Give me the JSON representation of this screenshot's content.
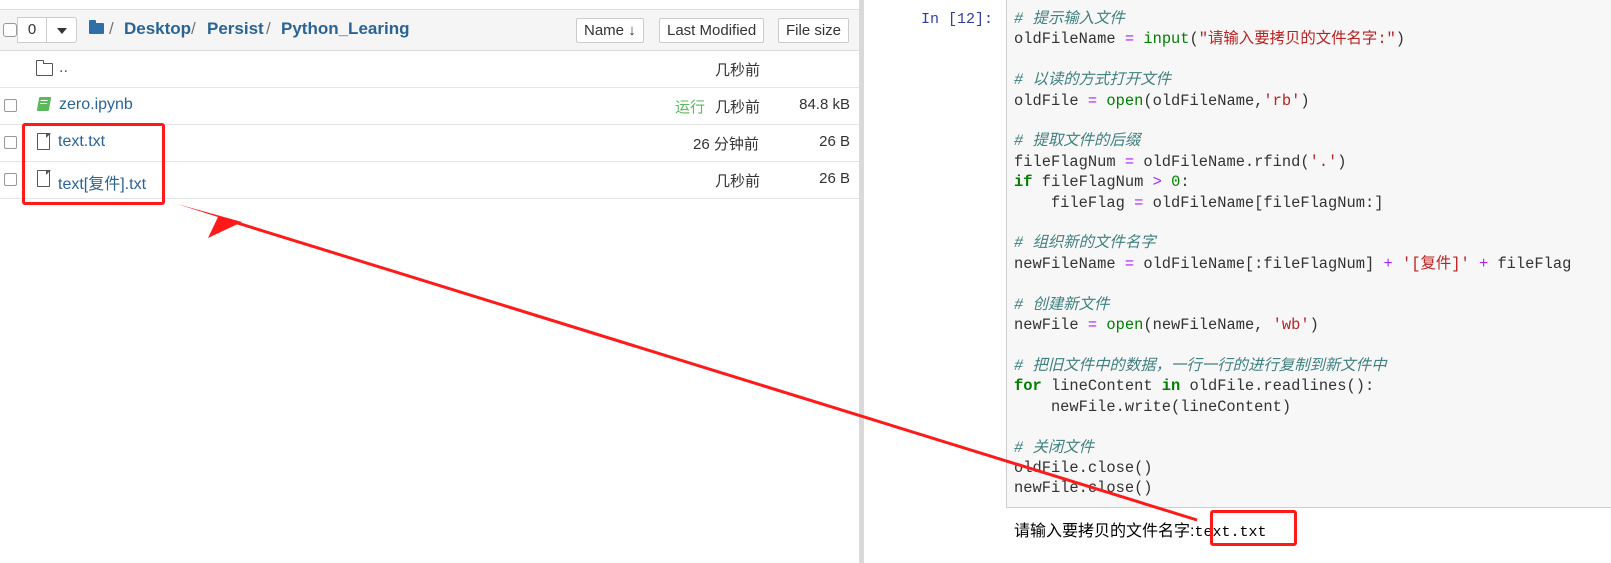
{
  "file_browser": {
    "selected_count": "0",
    "breadcrumb": [
      "Desktop",
      "Persist",
      "Python_Learing"
    ],
    "breadcrumb_sep": "/",
    "sort": {
      "name_label": "Name",
      "name_arrow": "🡻",
      "modified_label": "Last Modified",
      "size_label": "File size"
    },
    "rows": [
      {
        "name": "..",
        "icon": "folder-icon",
        "running": "",
        "modified": "几秒前",
        "size": ""
      },
      {
        "name": "zero.ipynb",
        "icon": "notebook-icon",
        "running": "运行",
        "modified": "几秒前",
        "size": "84.8 kB"
      },
      {
        "name": "text.txt",
        "icon": "file-icon",
        "running": "",
        "modified": "26 分钟前",
        "size": "26 B"
      },
      {
        "name": "text[复件].txt",
        "icon": "file-icon",
        "running": "",
        "modified": "几秒前",
        "size": "26 B"
      }
    ]
  },
  "notebook": {
    "prompt": "In  [12]:",
    "code_lines": [
      "# 提示输入文件",
      "oldFileName = input(\"请输入要拷贝的文件名字:\")",
      "",
      "# 以读的方式打开文件",
      "oldFile = open(oldFileName,'rb')",
      "",
      "# 提取文件的后缀",
      "fileFlagNum = oldFileName.rfind('.')",
      "if fileFlagNum > 0:",
      "    fileFlag = oldFileName[fileFlagNum:]",
      "",
      "# 组织新的文件名字",
      "newFileName = oldFileName[:fileFlagNum] + '[复件]' + fileFlag",
      "",
      "# 创建新文件",
      "newFile = open(newFileName, 'wb')",
      "",
      "# 把旧文件中的数据，一行一行的进行复制到新文件中",
      "for lineContent in oldFile.readlines():",
      "    newFile.write(lineContent)",
      "",
      "# 关闭文件",
      "oldFile.close()",
      "newFile.close()"
    ],
    "output_prompt": "请输入要拷贝的文件名字:",
    "output_value": "text.txt"
  },
  "annotation_color": "#ff1a1a"
}
